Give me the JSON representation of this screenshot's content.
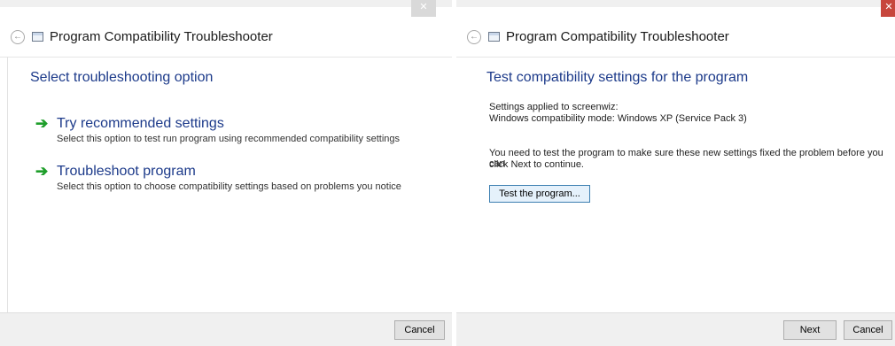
{
  "left_dialog": {
    "close_glyph": "✕",
    "back_glyph": "←",
    "app_title": "Program Compatibility Troubleshooter",
    "heading": "Select troubleshooting option",
    "options": [
      {
        "title": "Try recommended settings",
        "description": "Select this option to test run program using recommended compatibility settings"
      },
      {
        "title": "Troubleshoot program",
        "description": "Select this option to choose compatibility settings based on problems you notice"
      }
    ],
    "cancel_label": "Cancel"
  },
  "right_dialog": {
    "close_glyph": "✕",
    "back_glyph": "←",
    "app_title": "Program Compatibility Troubleshooter",
    "heading": "Test compatibility settings for the program",
    "settings_applied": "Settings applied to screenwiz:",
    "compat_mode": "Windows compatibility mode: Windows XP (Service Pack 3)",
    "instruction_line1": "You need to test the program to make sure these new settings fixed the problem before you can",
    "instruction_line2": "click Next to continue.",
    "test_button_label": "Test the program...",
    "next_label": "Next",
    "cancel_label": "Cancel"
  },
  "icons": {
    "option_arrow": "➔"
  },
  "colors": {
    "heading_blue": "#1c3a8a",
    "arrow_green": "#1e9e2a",
    "close_red": "#c7463c"
  }
}
